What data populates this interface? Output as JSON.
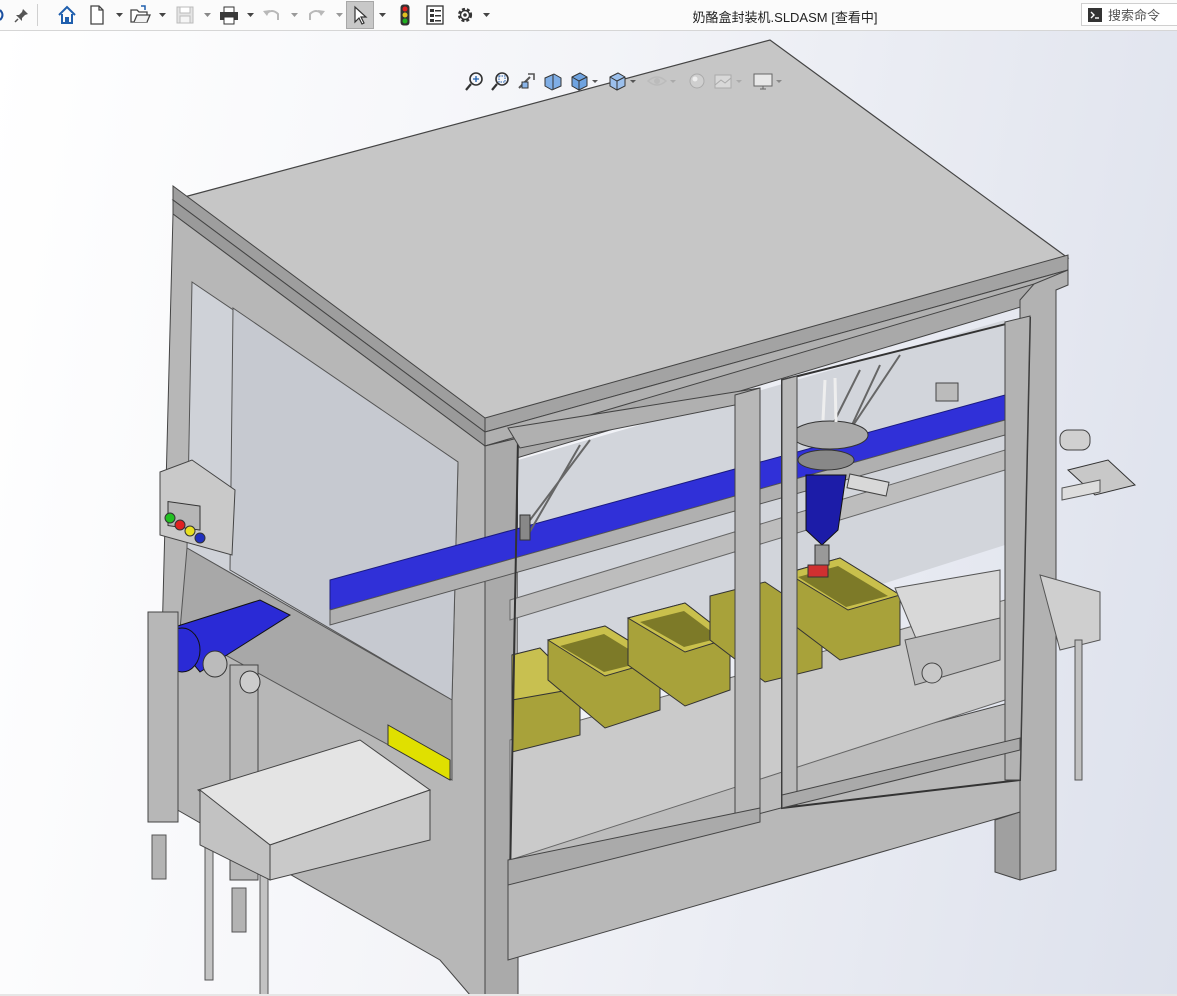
{
  "titlebar": {
    "document_title": "奶酪盒封装机.SLDASM [查看中]",
    "search_placeholder": "搜索命令",
    "tools": [
      {
        "name": "home-icon"
      },
      {
        "name": "new-document-icon"
      },
      {
        "name": "open-icon"
      },
      {
        "name": "save-icon"
      },
      {
        "name": "print-icon"
      },
      {
        "name": "undo-icon"
      },
      {
        "name": "redo-icon"
      },
      {
        "name": "select-pointer-icon"
      },
      {
        "name": "rebuild-traffic-light-icon"
      },
      {
        "name": "file-properties-icon"
      },
      {
        "name": "options-gear-icon"
      }
    ]
  },
  "headsup_toolbar": {
    "tools": [
      "zoom-to-fit-icon",
      "zoom-to-area-icon",
      "previous-view-icon",
      "section-view-icon",
      "view-orientation-icon",
      "display-style-icon",
      "hide-show-items-icon",
      "edit-appearance-icon",
      "apply-scene-icon",
      "view-settings-icon"
    ]
  },
  "model": {
    "name": "奶酪盒封装机",
    "colors": {
      "frame": "#b9b9b9",
      "frame_dark": "#8e8e8e",
      "top_panel": "#c4c4c4",
      "glass": "#c9cdd4",
      "conveyor_belt": "#2a2ad6",
      "boxes": "#a8a23a",
      "box_inner": "#7d7a28",
      "led_green": "#22c022",
      "led_red": "#e02020",
      "led_yellow": "#e8e020",
      "led_blue": "#2030c0"
    }
  }
}
